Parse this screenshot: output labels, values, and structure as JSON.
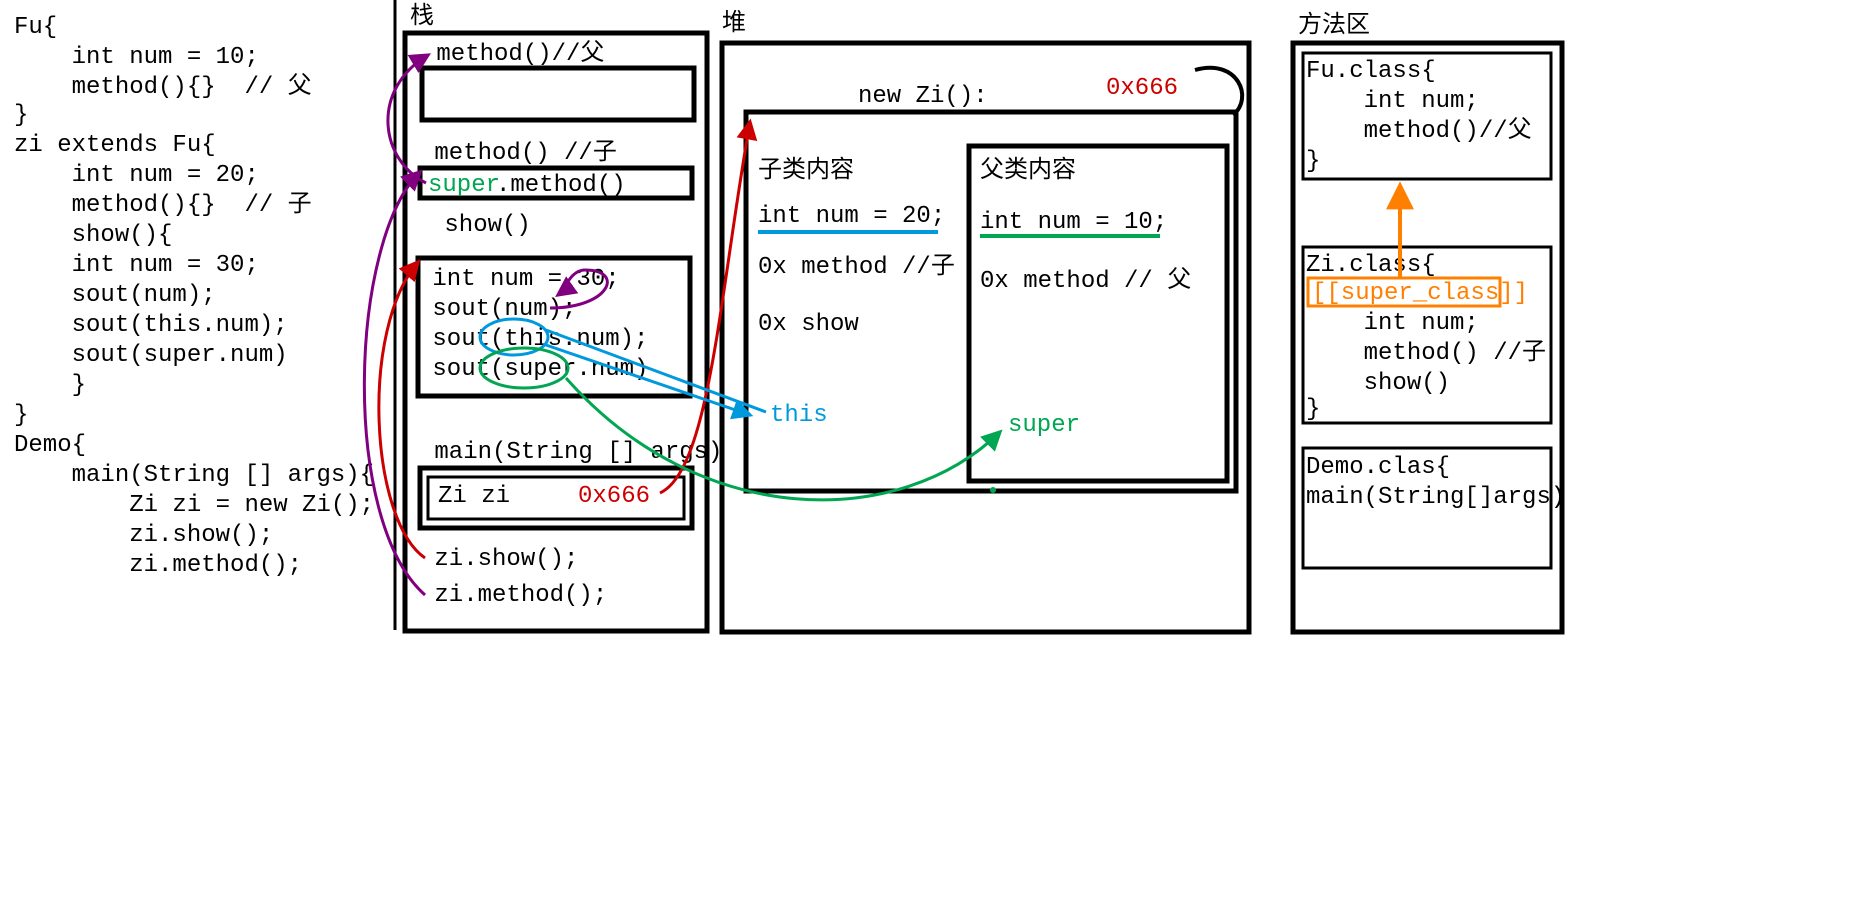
{
  "colors": {
    "black": "#000000",
    "red": "#cc0000",
    "purple": "#800080",
    "green": "#00a651",
    "blue": "#0099dd",
    "orange": "#ff8000"
  },
  "code": {
    "line1": "Fu{",
    "line2": "    int num = 10;",
    "line3": "    method(){}  // 父",
    "line4": "}",
    "line5": "zi extends Fu{",
    "line6": "    int num = 20;",
    "line7": "    method(){}  // 子",
    "line8": "    show(){",
    "line9": "    int num = 30;",
    "line10": "    sout(num);",
    "line11": "    sout(this.num);",
    "line12": "    sout(super.num)",
    "line13": "    }",
    "line14": "}",
    "line15": "Demo{",
    "line16": "    main(String [] args){",
    "line17": "        Zi zi = new Zi();",
    "line18": "        zi.show();",
    "line19": "        zi.method();"
  },
  "stack": {
    "title": "栈",
    "frame1": {
      "header": " method()//父"
    },
    "frame2": {
      "header": " method() //子",
      "super_prefix": "super",
      "super_rest": ".method()"
    },
    "show_label": " show()",
    "frame3": {
      "l1": " int num = 30;",
      "l2": " sout(num);",
      "l3": " sout(this.num);",
      "l4": " sout(super.num)"
    },
    "frame4": {
      "header": " main(String [] args)",
      "zi_var": "Zi zi",
      "zi_addr": "0x666",
      "call1": " zi.show();",
      "call2": " zi.method();"
    }
  },
  "heap": {
    "title": "堆",
    "new_zi": "new Zi():",
    "addr": "0x666",
    "child": {
      "title": "子类内容",
      "num": "int num = 20;",
      "method": "0x method //子",
      "show": "0x show"
    },
    "parent": {
      "title": "父类内容",
      "num": "int num = 10;",
      "method": "0x method // 父"
    },
    "this_label": "this",
    "super_label": "super"
  },
  "method_area": {
    "title": "方法区",
    "fu": {
      "header": "Fu.class{",
      "num": "    int num;",
      "method": "    method()//父",
      "close": "}"
    },
    "zi": {
      "header": "Zi.class{",
      "super_class": "[[super_class]]",
      "num": "    int num;",
      "method": "    method() //子",
      "show": "    show()",
      "close": "}"
    },
    "demo": {
      "header": "Demo.clas{",
      "main": "main(String[]args)"
    }
  }
}
